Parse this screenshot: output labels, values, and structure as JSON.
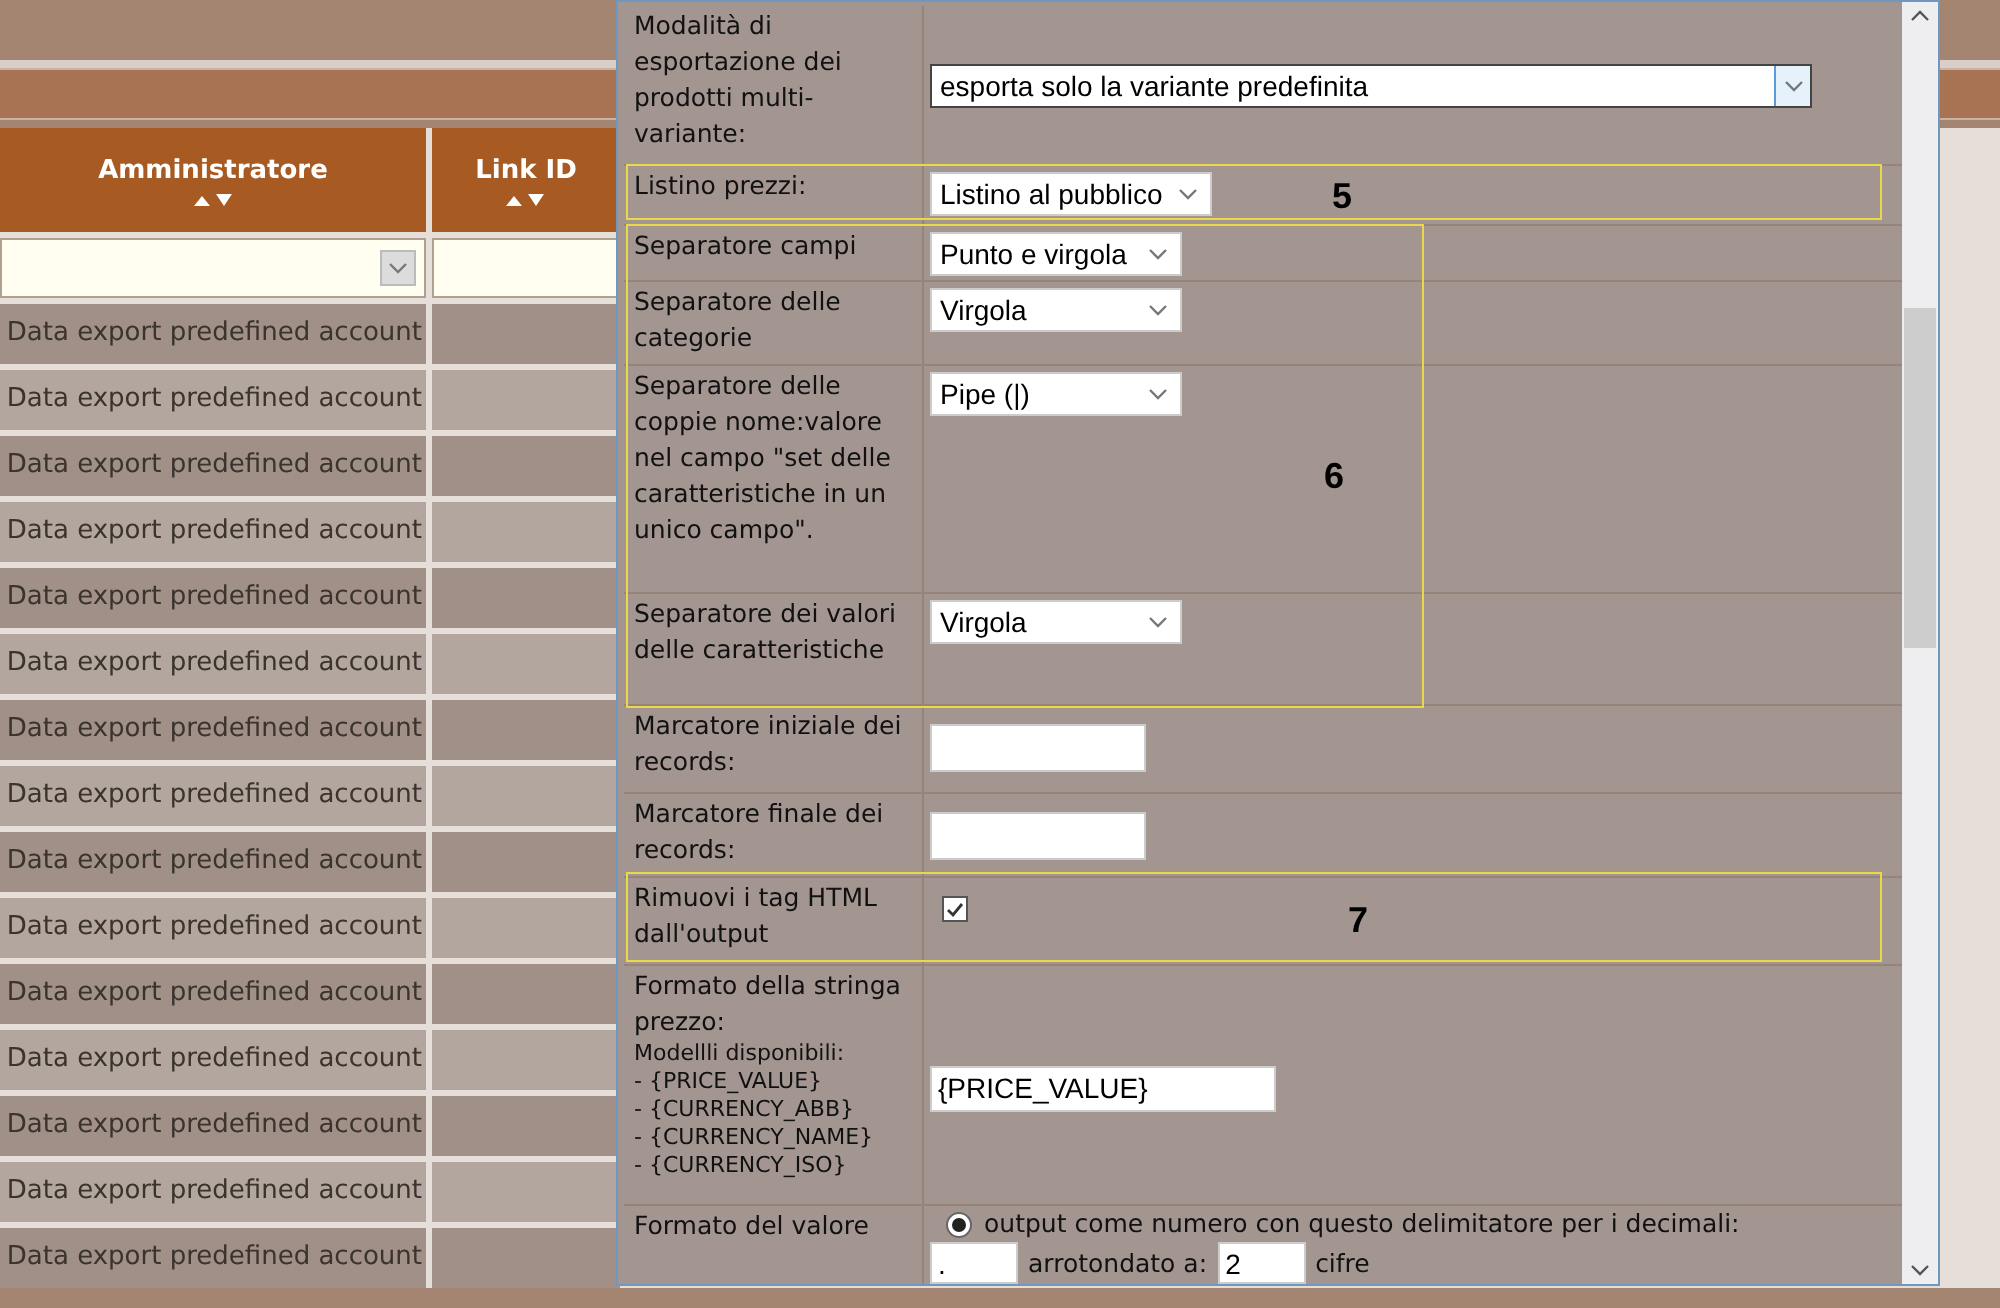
{
  "background": {
    "columns": [
      {
        "label": "Amministratore"
      },
      {
        "label": "Link ID"
      }
    ],
    "rows": [
      {
        "administrator": "Data export predefined account"
      },
      {
        "administrator": "Data export predefined account"
      },
      {
        "administrator": "Data export predefined account"
      },
      {
        "administrator": "Data export predefined account"
      },
      {
        "administrator": "Data export predefined account"
      },
      {
        "administrator": "Data export predefined account"
      },
      {
        "administrator": "Data export predefined account"
      },
      {
        "administrator": "Data export predefined account"
      },
      {
        "administrator": "Data export predefined account"
      },
      {
        "administrator": "Data export predefined account"
      },
      {
        "administrator": "Data export predefined account"
      },
      {
        "administrator": "Data export predefined account"
      },
      {
        "administrator": "Data export predefined account"
      },
      {
        "administrator": "Data export predefined account"
      },
      {
        "administrator": "Data export predefined account"
      }
    ]
  },
  "dialog": {
    "rows": [
      {
        "kind": "wide_select",
        "label": "Modalità di esportazione dei prodotti multi-variante:",
        "value": "esporta solo la variante predefinita"
      },
      {
        "kind": "select",
        "label": "Listino prezzi:",
        "value": "Listino al pubblico"
      },
      {
        "kind": "select",
        "label": "Separatore campi",
        "value": "Punto e virgola"
      },
      {
        "kind": "select",
        "label": "Separatore delle categorie",
        "value": "Virgola"
      },
      {
        "kind": "select",
        "label": "Separatore delle coppie nome:valore nel campo \"set delle caratteristiche in un unico campo\".",
        "value": "Pipe (|)"
      },
      {
        "kind": "select",
        "label": "Separatore dei valori delle caratteristiche",
        "value": "Virgola"
      },
      {
        "kind": "input",
        "label": "Marcatore iniziale dei records:"
      },
      {
        "kind": "input",
        "label": "Marcatore finale dei records:"
      },
      {
        "kind": "checkbox",
        "label": "Rimuovi i tag HTML dall'output",
        "checked": true
      },
      {
        "kind": "template",
        "label": "Formato della stringa prezzo:",
        "hints": [
          "Modellli disponibili:",
          "- {PRICE_VALUE}",
          "- {CURRENCY_ABB}",
          "- {CURRENCY_NAME}",
          "- {CURRENCY_ISO}"
        ],
        "value": "{PRICE_VALUE}"
      },
      {
        "kind": "number_format",
        "label": "Formato del valore",
        "option": {
          "label": "output come numero con questo delimitatore per i decimali:",
          "selected": true
        },
        "delimiter": ".",
        "rounding_label": "arrotondato a:",
        "digits": "2",
        "unit": "cifre"
      }
    ],
    "annotations": [
      {
        "number": "5"
      },
      {
        "number": "6"
      },
      {
        "number": "7"
      }
    ]
  }
}
